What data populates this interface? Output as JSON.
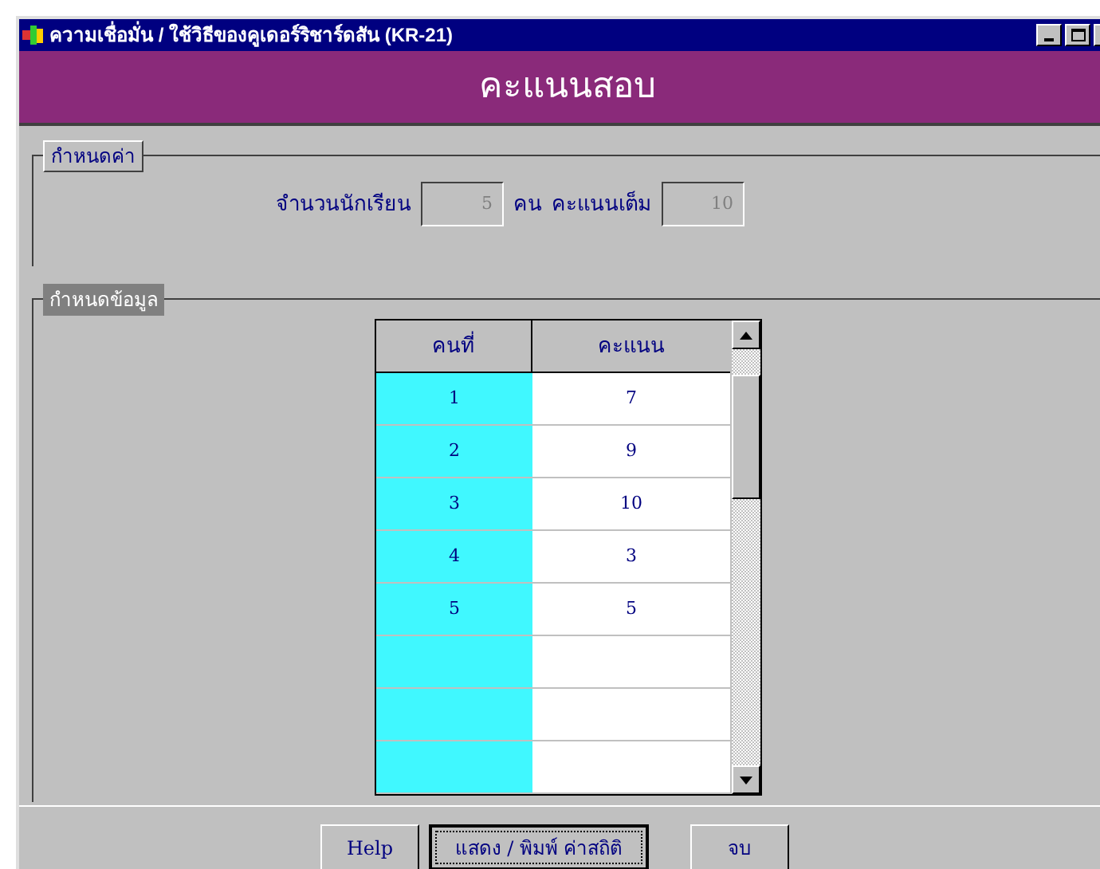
{
  "window": {
    "title": "ความเชื่อมั่น / ใช้วิธีของคูเดอร์ริชาร์ดสัน (KR-21)"
  },
  "header": {
    "title": "คะแนนสอบ"
  },
  "settings": {
    "legend": "กำหนดค่า",
    "students_label": "จำนวนนักเรียน",
    "students_value": "5",
    "unit": "คน",
    "full_score_label": "คะแนนเต็ม",
    "full_score_value": "10"
  },
  "data_group": {
    "legend": "กำหนดข้อมูล"
  },
  "table": {
    "columns": [
      "คนที่",
      "คะแนน"
    ],
    "rows": [
      {
        "no": "1",
        "score": "7"
      },
      {
        "no": "2",
        "score": "9"
      },
      {
        "no": "3",
        "score": "10"
      },
      {
        "no": "4",
        "score": "3"
      },
      {
        "no": "5",
        "score": "5"
      }
    ]
  },
  "buttons": [
    {
      "label": "Help",
      "focused": false
    },
    {
      "label": "แสดง / พิมพ์ ค่าสถิติ",
      "focused": true
    },
    {
      "label": "จบ",
      "focused": false
    }
  ]
}
